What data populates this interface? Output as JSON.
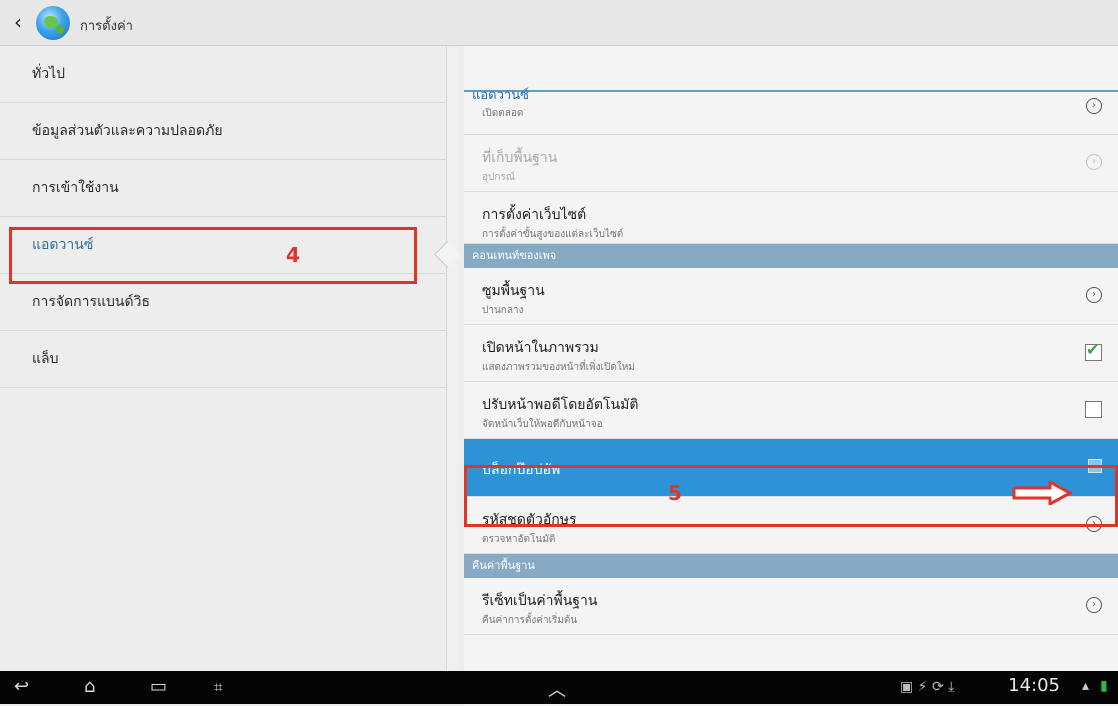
{
  "actionbar": {
    "back": "‹",
    "title": "การตั้งค่า"
  },
  "left_menu": [
    {
      "label": "ทั่วไป"
    },
    {
      "label": "ข้อมูลส่วนตัวและความปลอดภัย"
    },
    {
      "label": "การเข้าใช้งาน"
    },
    {
      "label": "แอดวานซ์"
    },
    {
      "label": "การจัดการแบนด์วิธ"
    },
    {
      "label": "แล็บ"
    }
  ],
  "right": {
    "header": "แอดวานซ์",
    "cut_row_sub": "เปิดตลอด",
    "rows_top": [
      {
        "title": "ที่เก็บพื้นฐาน",
        "sub": "อุปกรณ์",
        "dim": true
      },
      {
        "title": "การตั้งค่าเว็บไซต์",
        "sub": "การตั้งค่าขั้นสูงของแต่ละเว็บไซต์"
      }
    ],
    "section1": "คอนเทนท์ของเพจ",
    "rows_mid": [
      {
        "title": "ซูมพื้นฐาน",
        "sub": "ปานกลาง"
      },
      {
        "title": "เปิดหน้าในภาพรวม",
        "sub": "แสดงภาพรวมของหน้าที่เพิ่งเปิดใหม่"
      },
      {
        "title": "ปรับหน้าพอดีโดยอัตโนมัติ",
        "sub": "จัดหน้าเว็บให้พอดีกับหน้าจอ"
      }
    ],
    "popup_row": {
      "title": "บล็อกป๊อปอัพ"
    },
    "rows_after": [
      {
        "title": "รหัสชุดตัวอักษร",
        "sub": "ตรวจหาอัตโนมัติ"
      }
    ],
    "section2": "คืนค่าพื้นฐาน",
    "rows_bottom": [
      {
        "title": "รีเซ็ทเป็นค่าพื้นฐาน",
        "sub": "คืนค่าการตั้งค่าเริ่มต้น"
      }
    ]
  },
  "annotations": {
    "step4": "4",
    "step5": "5",
    "accent": "#e0332a"
  },
  "statusbar": {
    "time": "14:05"
  },
  "icons": [
    "back-icon",
    "browser-globe-icon",
    "chevron-right-icon",
    "checkbox-icon",
    "red-arrow-icon",
    "nav-back-icon",
    "nav-home-icon",
    "nav-recent-icon",
    "screenshot-icon",
    "chevron-up-icon",
    "signal-icon",
    "battery-icon"
  ]
}
